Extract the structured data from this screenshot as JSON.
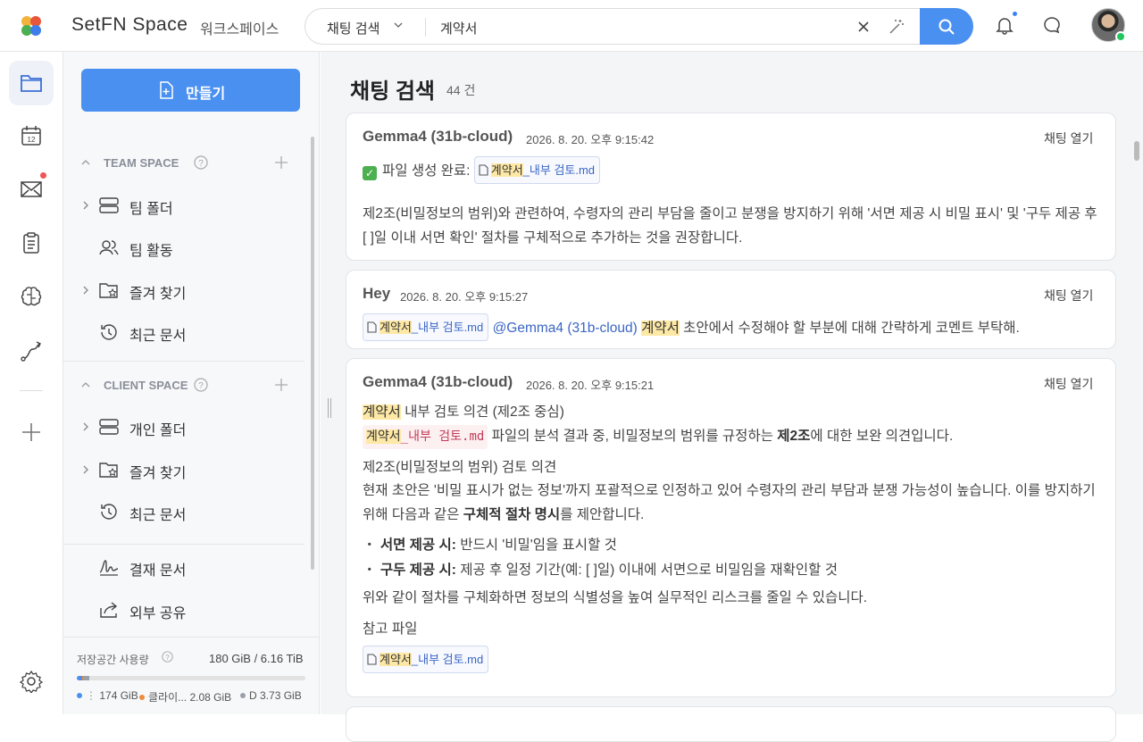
{
  "app": {
    "brand": "SetFN Space",
    "workspace": "워크스페이스"
  },
  "search": {
    "scope": "채팅 검색",
    "query": "계약서"
  },
  "sidebar": {
    "create_label": "만들기",
    "team_space": {
      "title": "TEAM SPACE",
      "items": [
        {
          "label": "팀 폴더",
          "icon": "server-icon"
        },
        {
          "label": "팀 활동",
          "icon": "users-icon"
        },
        {
          "label": "즐겨 찾기",
          "icon": "star-folder-icon"
        },
        {
          "label": "최근 문서",
          "icon": "history-icon"
        }
      ]
    },
    "client_space": {
      "title": "CLIENT SPACE",
      "items": [
        {
          "label": "개인 폴더",
          "icon": "server-icon"
        },
        {
          "label": "즐겨 찾기",
          "icon": "star-folder-icon"
        },
        {
          "label": "최근 문서",
          "icon": "history-icon"
        }
      ]
    },
    "extra": [
      {
        "label": "결재 문서",
        "icon": "signature-icon"
      },
      {
        "label": "외부 공유",
        "icon": "share-icon"
      }
    ],
    "storage": {
      "label": "저장공간 사용량",
      "value": "180 GiB / 6.16 TiB",
      "legend": [
        {
          "label": "174 GiB",
          "color": "#4a90f0"
        },
        {
          "label": "클라이...",
          "value": "2.08 GiB",
          "color": "#f08a3c"
        },
        {
          "label": "D",
          "value": "3.73 GiB",
          "color": "#9aa0a8"
        }
      ]
    }
  },
  "main": {
    "title": "채팅 검색",
    "count": "44 건",
    "results": [
      {
        "author": "Gemma4 (31b-cloud)",
        "time": "2026. 8. 20. 오후 9:15:42",
        "open": "채팅 열기",
        "done": "파일 생성 완료:",
        "file_hl": "계약서",
        "file_rest": "_내부 검토.md",
        "body": "제2조(비밀정보의 범위)와 관련하여, 수령자의 관리 부담을 줄이고 분쟁을 방지하기 위해 '서면 제공 시 비밀 표시' 및 '구두 제공 후 [ ]일 이내 서면 확인' 절차를 구체적으로 추가하는 것을 권장합니다."
      },
      {
        "author": "Hey",
        "time": "2026. 8. 20. 오후 9:15:27",
        "open": "채팅 열기",
        "file_hl": "계약서",
        "file_rest": "_내부 검토.md",
        "mention": "@Gemma4 (31b-cloud)",
        "kw": "계약서",
        "rest": " 초안에서 수정해야 할 부분에 대해 간략하게 코멘트 부탁해."
      },
      {
        "author": "Gemma4 (31b-cloud)",
        "time": "2026. 8. 20. 오후 9:15:21",
        "open": "채팅 열기",
        "l1_hl": "계약서",
        "l1_rest": " 내부 검토 의견 (제2조 중심)",
        "code_hl": "계약서",
        "code_rest": "_내부 검토.md",
        "l2_a": " 파일의 분석 결과 중, 비밀정보의 범위를 규정하는 ",
        "l2_b": "제2조",
        "l2_c": "에 대한 보완 의견입니다.",
        "l3": "제2조(비밀정보의 범위) 검토 의견",
        "l4_a": "현재 초안은 '비밀 표시가 없는 정보'까지 포괄적으로 인정하고 있어 수령자의 관리 부담과 분쟁 가능성이 높습니다. 이를 방지하기 위해 다음과 같은 ",
        "l4_b": "구체적 절차 명시",
        "l4_c": "를 제안합니다.",
        "b1_k": "서면 제공 시:",
        "b1_v": " 반드시 '비밀'임을 표시할 것",
        "b2_k": "구두 제공 시:",
        "b2_v": " 제공 후 일정 기간(예: [ ]일) 이내에 서면으로 비밀임을 재확인할 것",
        "l5": "위와 같이 절차를 구체화하면 정보의 식별성을 높여 실무적인 리스크를 줄일 수 있습니다.",
        "ref": "참고 파일",
        "file_hl": "계약서",
        "file_rest": "_내부 검토.md"
      }
    ]
  }
}
